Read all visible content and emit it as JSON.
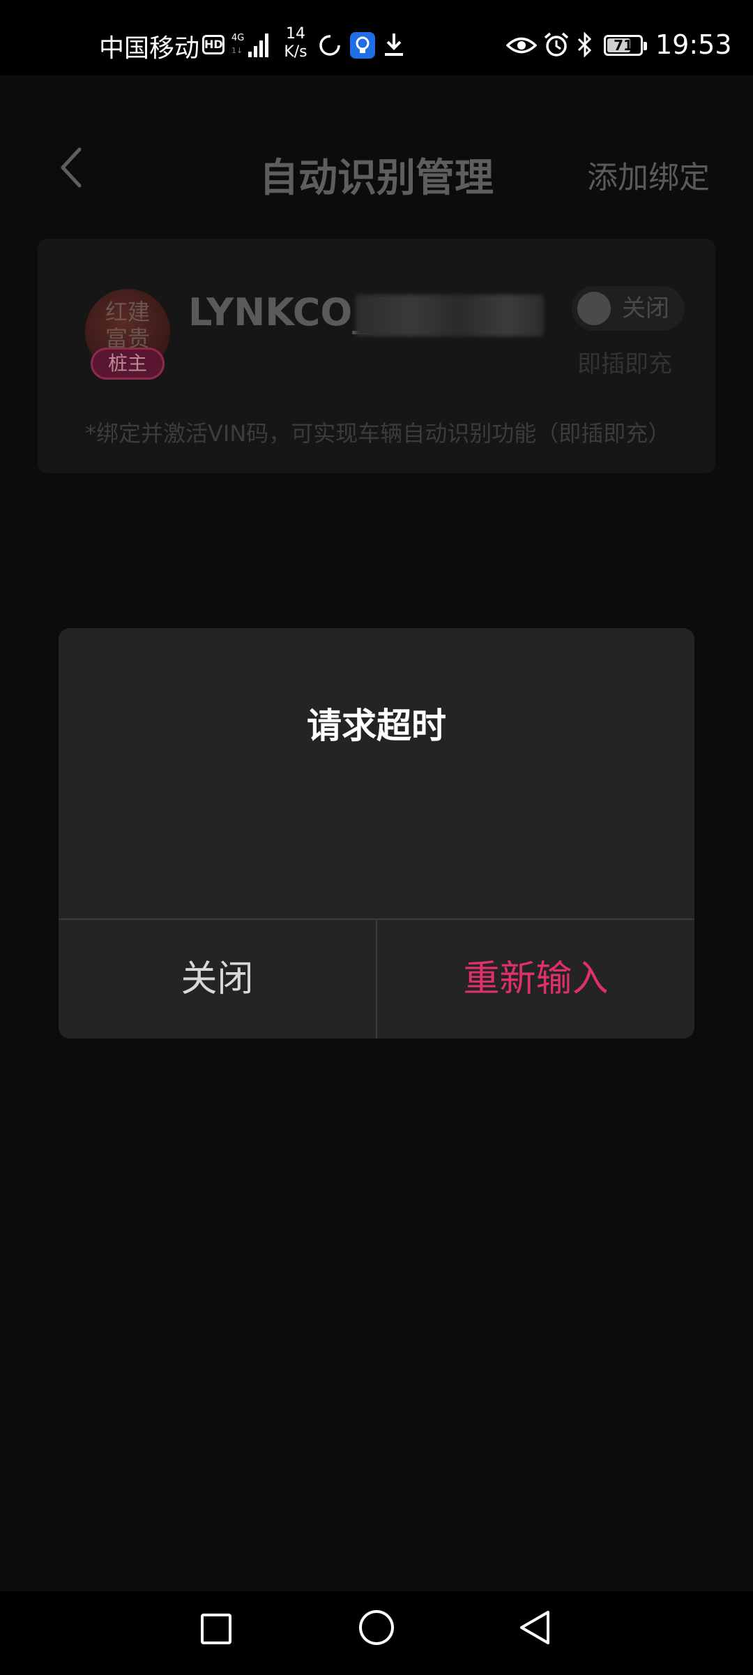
{
  "status_bar": {
    "carrier": "中国移动",
    "hd": "HD",
    "speed_value": "14",
    "speed_unit": "K/s",
    "battery": "71",
    "time": "19:53",
    "icons": [
      "hd-icon",
      "signal-icon",
      "loading-ring-icon",
      "bulb-app-icon",
      "download-icon",
      "eye-icon",
      "alarm-icon",
      "bluetooth-icon",
      "battery-icon"
    ]
  },
  "header": {
    "title": "自动识别管理",
    "add_bind": "添加绑定"
  },
  "card": {
    "device_name": "LYNKCO_2",
    "avatar_art": "红建\n富贵",
    "owner_badge": "桩主",
    "toggle_label": "关闭",
    "plug_label": "即插即充",
    "note": "*绑定并激活VIN码，可实现车辆自动识别功能（即插即充）",
    "accent": "#8c2a4c"
  },
  "dialog": {
    "title": "请求超时",
    "close_label": "关闭",
    "retry_label": "重新输入",
    "retry_color": "#e0306a"
  },
  "nav": {
    "icons": [
      "recents-square-icon",
      "home-circle-icon",
      "back-triangle-icon"
    ]
  }
}
